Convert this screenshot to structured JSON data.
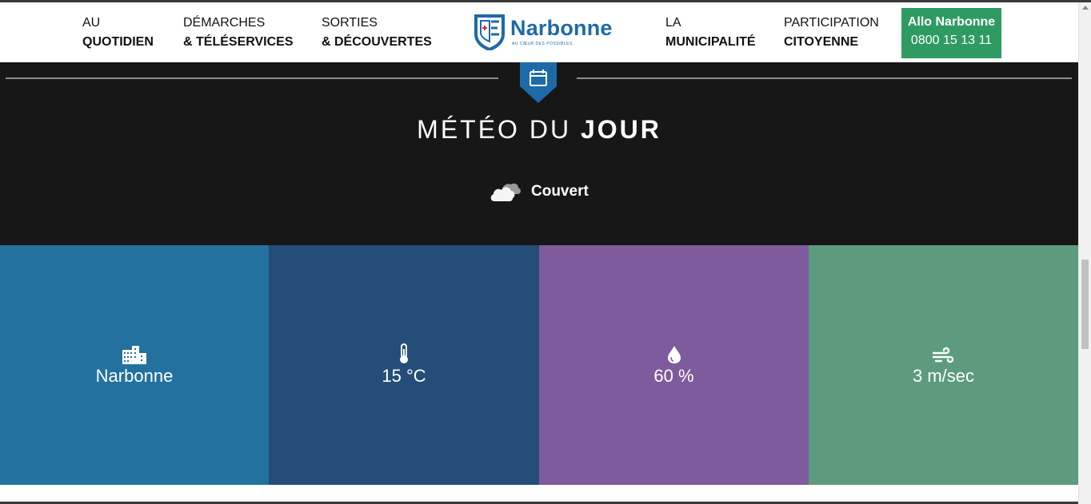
{
  "nav": {
    "items": [
      {
        "line1": "AU",
        "line2": "QUOTIDIEN"
      },
      {
        "line1": "DÉMARCHES",
        "line2": "& TÉLÉSERVICES"
      },
      {
        "line1": "SORTIES",
        "line2": "& DÉCOUVERTES"
      },
      {
        "line1": "LA",
        "line2": "MUNICIPALITÉ"
      },
      {
        "line1": "PARTICIPATION",
        "line2": "CITOYENNE"
      }
    ],
    "logo": {
      "name": "Narbonne",
      "tagline": "AU CŒUR DES POSSIBLES"
    },
    "allo": {
      "title": "Allo Narbonne",
      "phone": "0800 15 13 11"
    }
  },
  "weather": {
    "title_light": "MÉTÉO DU",
    "title_bold": "JOUR",
    "condition": "Couvert",
    "condition_icon": "cloud-icon",
    "tiles": [
      {
        "icon": "city-icon",
        "value": "Narbonne",
        "color": "#23719f"
      },
      {
        "icon": "thermometer-icon",
        "value": "15 °C",
        "color": "#244e78"
      },
      {
        "icon": "droplet-icon",
        "value": "60 %",
        "color": "#7e5b9c"
      },
      {
        "icon": "wind-icon",
        "value": "3 m/sec",
        "color": "#5c9b7d"
      }
    ]
  },
  "colors": {
    "brand_blue": "#1e6aa8",
    "allo_green": "#2e9b62",
    "dark_bg": "#171717"
  }
}
